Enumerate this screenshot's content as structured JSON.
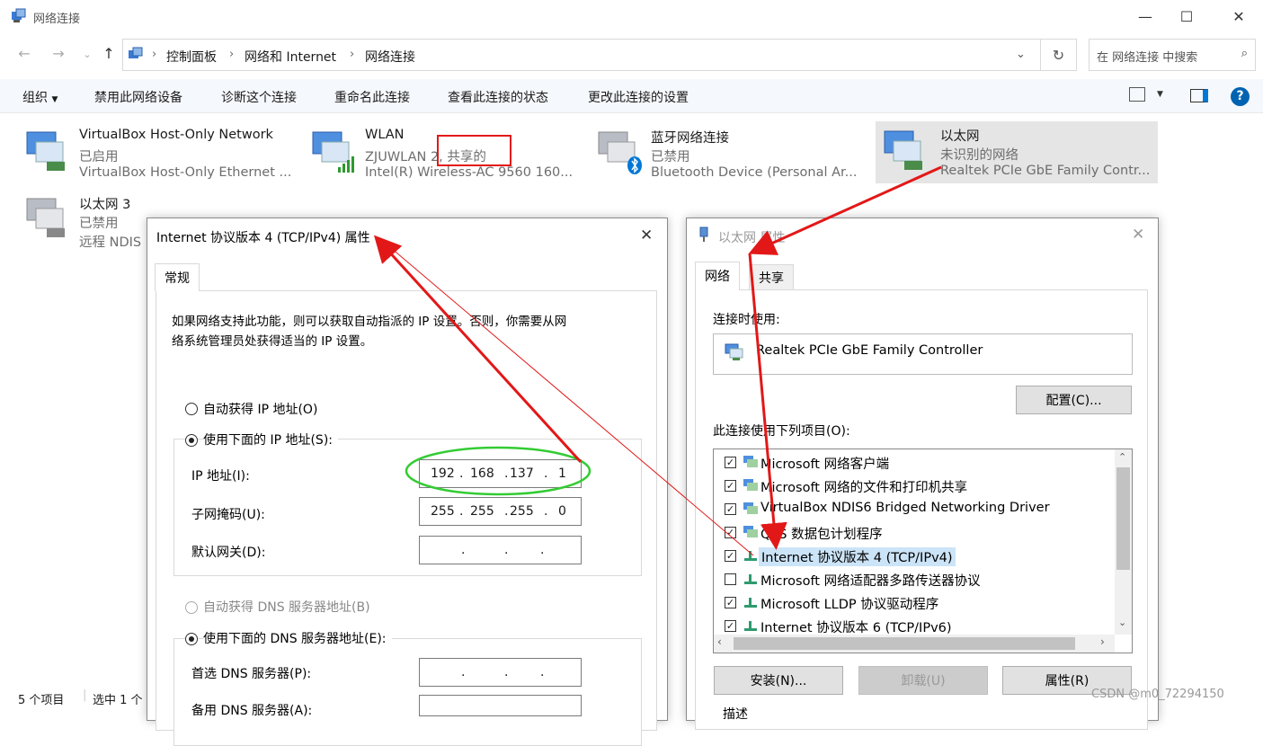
{
  "window": {
    "title": "网络连接"
  },
  "address": {
    "crumbs": [
      "控制面板",
      "网络和 Internet",
      "网络连接"
    ],
    "search_placeholder": "在 网络连接 中搜索"
  },
  "toolbar": {
    "organize": "组织",
    "items": [
      "禁用此网络设备",
      "诊断这个连接",
      "重命名此连接",
      "查看此连接的状态",
      "更改此连接的设置"
    ]
  },
  "connections": [
    {
      "name": "VirtualBox Host-Only Network",
      "status": "已启用",
      "device": "VirtualBox Host-Only Ethernet ..."
    },
    {
      "name": "WLAN",
      "status": "ZJUWLAN 2, 共享的",
      "device": "Intel(R) Wireless-AC 9560 160..."
    },
    {
      "name": "蓝牙网络连接",
      "status": "已禁用",
      "device": "Bluetooth Device (Personal Ar..."
    },
    {
      "name": "以太网",
      "status": "未识别的网络",
      "device": "Realtek PCIe GbE Family Contr..."
    },
    {
      "name": "以太网 3",
      "status": "已禁用",
      "device": "远程 NDIS"
    }
  ],
  "statusbar": {
    "count": "5 个项目",
    "selected": "选中 1 个"
  },
  "ipv4": {
    "title": "Internet 协议版本 4 (TCP/IPv4) 属性",
    "tab": "常规",
    "desc_line1": "如果网络支持此功能，则可以获取自动指派的 IP 设置。否则，你需要从网",
    "desc_line2": "络系统管理员处获得适当的 IP 设置。",
    "auto_ip": "自动获得 IP 地址(O)",
    "manual_ip": "使用下面的 IP 地址(S):",
    "ip_label": "IP 地址(I):",
    "ip": [
      "192",
      "168",
      "137",
      "1"
    ],
    "mask_label": "子网掩码(U):",
    "mask": [
      "255",
      "255",
      "255",
      "0"
    ],
    "gateway_label": "默认网关(D):",
    "auto_dns": "自动获得 DNS 服务器地址(B)",
    "manual_dns": "使用下面的 DNS 服务器地址(E):",
    "dns1_label": "首选 DNS 服务器(P):",
    "dns2_label": "备用 DNS 服务器(A):"
  },
  "eth": {
    "title": "以太网 属性",
    "tab_network": "网络",
    "tab_share": "共享",
    "connect_using": "连接时使用:",
    "adapter": "Realtek PCIe GbE Family Controller",
    "config_btn": "配置(C)...",
    "items_label": "此连接使用下列项目(O):",
    "items": [
      {
        "label": "Microsoft 网络客户端",
        "checked": true
      },
      {
        "label": "Microsoft 网络的文件和打印机共享",
        "checked": true
      },
      {
        "label": "VirtualBox NDIS6 Bridged Networking Driver",
        "checked": true
      },
      {
        "label": "QoS 数据包计划程序",
        "checked": true
      },
      {
        "label": "Internet 协议版本 4 (TCP/IPv4)",
        "checked": true
      },
      {
        "label": "Microsoft 网络适配器多路传送器协议",
        "checked": false
      },
      {
        "label": "Microsoft LLDP 协议驱动程序",
        "checked": true
      },
      {
        "label": "Internet 协议版本 6 (TCP/IPv6)",
        "checked": true
      }
    ],
    "install_btn": "安装(N)...",
    "uninstall_btn": "卸载(U)",
    "props_btn": "属性(R)",
    "desc_label": "描述"
  },
  "watermark": "CSDN @m0_72294150",
  "colors": {
    "accent": "#0078d7",
    "annotation": "#e21818",
    "highlight": "#33cc33",
    "selection": "#cce4f7"
  }
}
